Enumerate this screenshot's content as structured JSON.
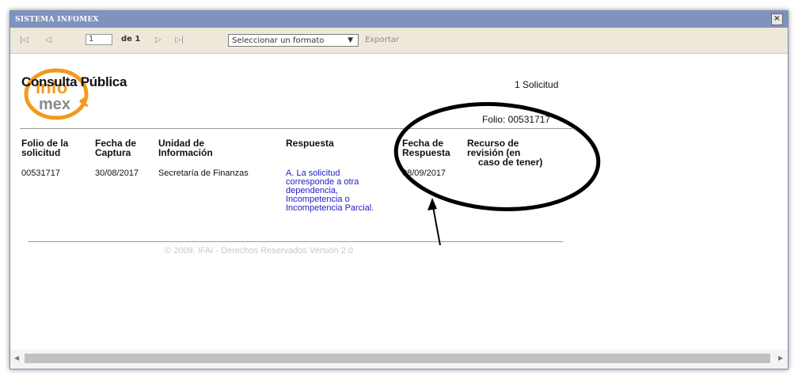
{
  "window": {
    "title": "SISTEMA INFOMEX",
    "close_glyph": "×"
  },
  "toolbar": {
    "first_icon": "first-page-icon",
    "prev_icon": "previous-page-icon",
    "page_value": "1",
    "of_label": "de 1",
    "next_icon": "next-page-icon",
    "last_icon": "last-page-icon",
    "format_select": "Seleccionar un formato",
    "export_label": "Exportar"
  },
  "report": {
    "heading": "Consulta Pública",
    "count": "1 Solicitud",
    "folio": "Folio: 00531717",
    "logo_text_top": "info",
    "logo_text_bottom": "mex",
    "columns": [
      [
        "Folio de la",
        "solicitud"
      ],
      [
        "Fecha de",
        "Captura"
      ],
      [
        "Unidad de",
        "Información"
      ],
      [
        "Respuesta"
      ],
      [
        "Fecha de",
        "Respuesta"
      ],
      [
        "Recurso de",
        "revisión (en",
        "caso de tener)"
      ]
    ],
    "row": {
      "folio": "00531717",
      "fecha_captura": "30/08/2017",
      "unidad": "Secretaría de Finanzas",
      "respuesta": [
        "A. La solicitud",
        "corresponde a otra",
        "dependencia,",
        "Incompetencia o",
        "Incompetencia Parcial."
      ],
      "fecha_respuesta": "08/09/2017",
      "recurso": ""
    },
    "copyright": "© 2009, IFAI - Derechos Reservados Versión 2.0"
  },
  "colors": {
    "titlebar": "#7f93bf",
    "toolbar": "#ede8d9",
    "link": "#2020c8",
    "logo_orange": "#f29a1d"
  }
}
